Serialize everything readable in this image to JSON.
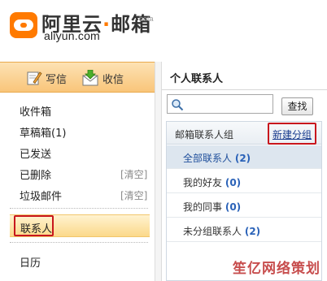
{
  "brand": {
    "name_cn_main": "阿里云",
    "name_cn_dot": "·",
    "name_cn_mail": "邮箱",
    "beta": "beta",
    "domain": "aliyun.com"
  },
  "toolbar": {
    "write_label": "写信",
    "receive_label": "收信"
  },
  "sidebar": {
    "folders": [
      {
        "label": "收件箱"
      },
      {
        "label": "草稿箱(1)"
      },
      {
        "label": "已发送"
      },
      {
        "label": "已删除",
        "action": "[清空]"
      },
      {
        "label": "垃圾邮件",
        "action": "[清空]"
      }
    ],
    "contacts_label": "联系人",
    "calendar_label": "日历"
  },
  "panel": {
    "title": "个人联系人",
    "search_placeholder": "",
    "search_button": "查找",
    "groups_header": "邮箱联系人组",
    "new_group_link": "新建分组",
    "groups": [
      {
        "name": "全部联系人",
        "count": "(2)",
        "selected": true
      },
      {
        "name": "我的好友",
        "count": "(0)",
        "selected": false
      },
      {
        "name": "我的同事",
        "count": "(0)",
        "selected": false
      },
      {
        "name": "未分组联系人",
        "count": "(2)",
        "selected": false
      }
    ]
  },
  "watermark": "笙亿网络策划",
  "colors": {
    "brand_orange": "#ff7a00",
    "highlight_red": "#c8161d",
    "link_blue": "#1a3d8f",
    "count_blue": "#2a62b8"
  }
}
